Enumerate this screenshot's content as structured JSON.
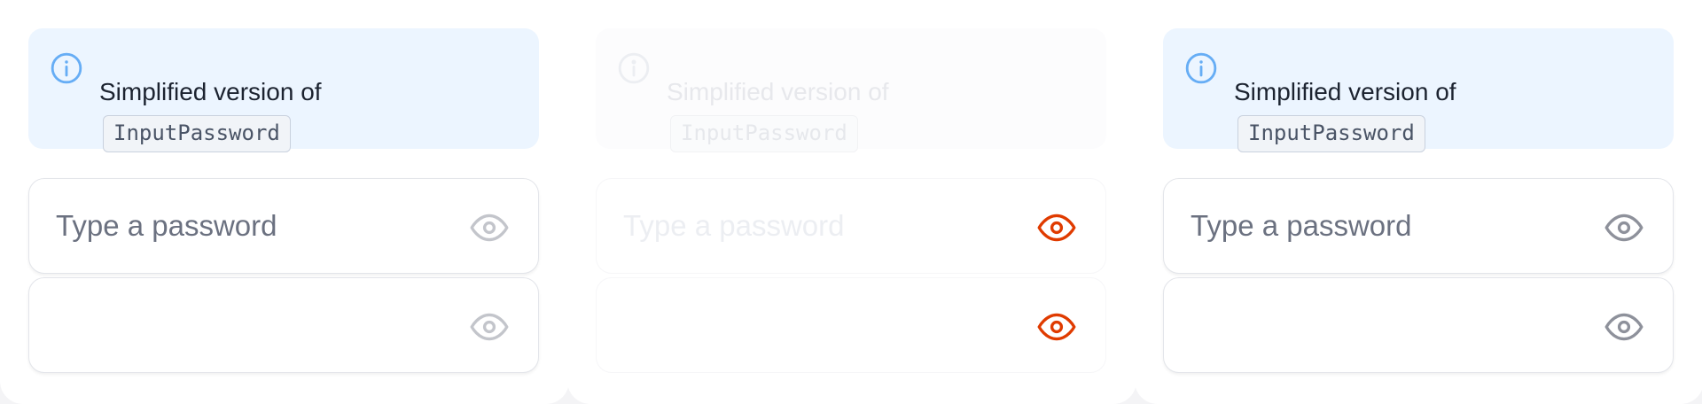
{
  "panels": [
    {
      "notice": {
        "text": "Simplified version of",
        "code": "InputPassword",
        "icon": "info-icon"
      },
      "password_field": {
        "placeholder": "Type a password",
        "value": "",
        "toggle_icon": "eye-icon"
      },
      "confirm_field": {
        "placeholder": "",
        "value": "",
        "toggle_icon": "eye-icon"
      }
    },
    {
      "notice": {
        "text": "Simplified version of",
        "code": "InputPassword",
        "icon": "info-icon"
      },
      "password_field": {
        "placeholder": "Type a password",
        "value": "",
        "toggle_icon": "eye-icon"
      },
      "confirm_field": {
        "placeholder": "",
        "value": "",
        "toggle_icon": "eye-icon"
      }
    },
    {
      "notice": {
        "text": "Simplified version of",
        "code": "InputPassword",
        "icon": "info-icon"
      },
      "password_field": {
        "placeholder": "Type a password",
        "value": "",
        "toggle_icon": "eye-icon"
      },
      "confirm_field": {
        "placeholder": "",
        "value": "",
        "toggle_icon": "eye-icon"
      }
    }
  ],
  "colors": {
    "info_accent": "#66adf5",
    "eye_default": "#c3c5cb",
    "eye_highlight": "#e03b00",
    "eye_active": "#8e919b",
    "notice_bg": "#ecf5ff"
  }
}
